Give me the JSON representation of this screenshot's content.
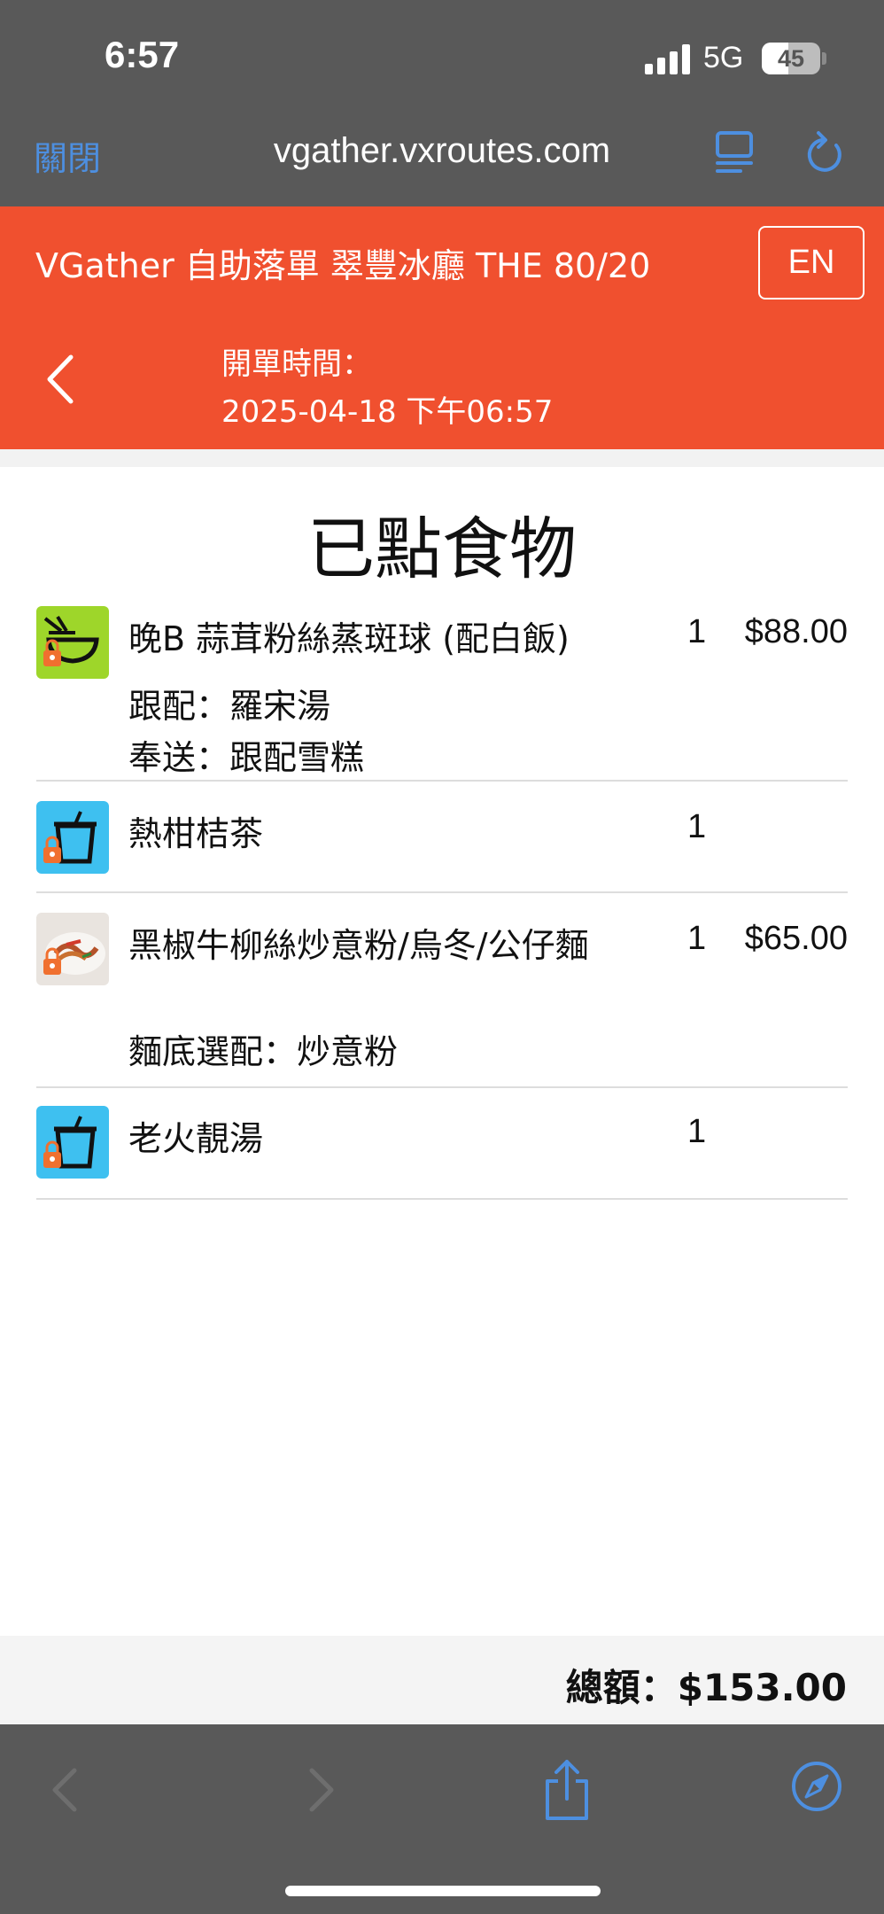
{
  "status_bar": {
    "time": "6:57",
    "network": "5G",
    "battery_level": 45,
    "battery_text": "45"
  },
  "browser": {
    "close_label": "關閉",
    "url": "vgather.vxroutes.com"
  },
  "header": {
    "store_title": "VGather 自助落單 翠豐冰廳 THE 80/20",
    "lang_button": "EN",
    "open_time_label": "開單時間：",
    "open_time_value": "2025-04-18 下午06:57"
  },
  "page_title": "已點食物",
  "items": [
    {
      "name": "晚B 蒜茸粉絲蒸斑球 (配白飯)",
      "options": [
        "跟配：羅宋湯",
        "奉送：跟配雪糕"
      ],
      "qty": "1",
      "price": "$88.00",
      "icon": "rice-bowl-icon",
      "thumb_color": "#9ed62a"
    },
    {
      "name": "熱柑桔茶",
      "options": [],
      "qty": "1",
      "price": "",
      "icon": "drink-cup-icon",
      "thumb_color": "#3ec0f0"
    },
    {
      "name": "黑椒牛柳絲炒意粉/烏冬/公仔麵",
      "options": [
        "麵底選配：炒意粉"
      ],
      "qty": "1",
      "price": "$65.00",
      "icon": "noodle-dish-photo",
      "thumb_color": "#e9e4df"
    },
    {
      "name": "老火靚湯",
      "options": [],
      "qty": "1",
      "price": "",
      "icon": "drink-cup-icon",
      "thumb_color": "#3ec0f0"
    }
  ],
  "total": {
    "label": "總額：",
    "amount": "$153.00",
    "text": "總額：$153.00"
  },
  "colors": {
    "header": "#f0502f",
    "browser_chrome": "#595959",
    "link_blue": "#4d8fe0"
  }
}
